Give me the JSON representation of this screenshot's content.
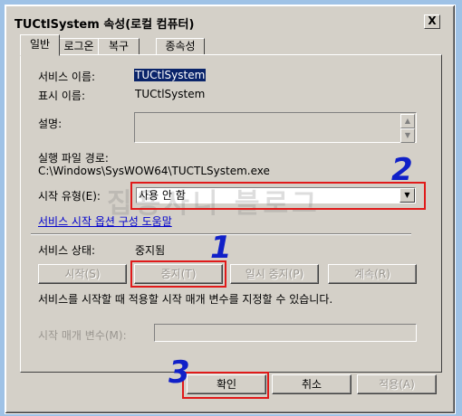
{
  "window": {
    "title": "TUCtlSystem 속성(로컬 컴퓨터)",
    "close_label": "X"
  },
  "tabs": [
    {
      "label": "일반"
    },
    {
      "label": "로그온"
    },
    {
      "label": "복구"
    },
    {
      "label": "종속성"
    }
  ],
  "general": {
    "service_name_label": "서비스 이름:",
    "service_name_value": "TUCtlSystem",
    "display_name_label": "표시 이름:",
    "display_name_value": "TUCtlSystem",
    "description_label": "설명:",
    "path_label": "실행 파일 경로:",
    "path_value": "C:\\Windows\\SysWOW64\\TUCTLSystem.exe",
    "startup_type_label": "시작 유형(E):",
    "startup_type_value": "사용 안 함",
    "help_link": "서비스 시작 옵션 구성 도움말",
    "status_label": "서비스 상태:",
    "status_value": "중지됨",
    "start_button": "시작(S)",
    "stop_button": "중지(T)",
    "pause_button": "일시 중지(P)",
    "resume_button": "계속(R)",
    "start_params_info": "서비스를 시작할 때 적용할 시작 매개 변수를 지정할 수 있습니다.",
    "start_params_label": "시작 매개 변수(M):"
  },
  "dialog_buttons": {
    "ok": "확인",
    "cancel": "취소",
    "apply": "적용(A)"
  },
  "annotations": {
    "step1": "1",
    "step2": "2",
    "step3": "3",
    "watermark": "집용사니 블로그"
  },
  "colors": {
    "annotation_box": "#e01a1a",
    "annotation_number": "#1020c8",
    "link": "#0000cc"
  }
}
